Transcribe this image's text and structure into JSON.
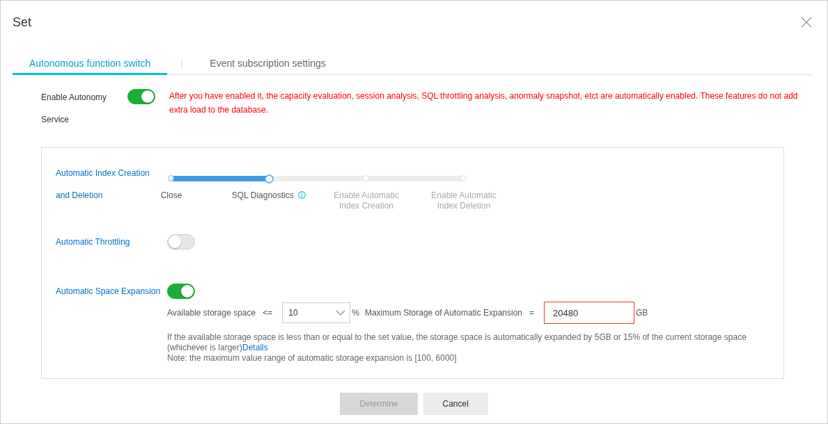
{
  "window": {
    "title": "Set"
  },
  "tabs": [
    {
      "label": "Autonomous function switch",
      "selected": true
    },
    {
      "label": "Event subscription settings",
      "selected": false
    }
  ],
  "autonomy": {
    "label": "Enable Autonomy Service",
    "on": true,
    "notice": "After you have enabled it, the capacity evaluation, session analysis, SQL throttling analysis, anormaly snapshot, etct are automatically enabled. These features do not add extra load to the database."
  },
  "index_setting": {
    "label": "Automatic Index Creation and Deletion",
    "level": 0.3333,
    "steps": [
      {
        "label": "Close",
        "selected": false,
        "info": false
      },
      {
        "label": "SQL Diagnostics",
        "selected": true,
        "info": true
      },
      {
        "label": "Enable Automatic Index Creation",
        "selected": false,
        "info": false
      },
      {
        "label": "Enable Automatic Index Deletion",
        "selected": false,
        "info": false
      }
    ]
  },
  "throttling": {
    "label": "Automatic Throttling",
    "on": false
  },
  "expansion": {
    "label": "Automatic Space Expansion",
    "on": true,
    "available_label": "Available storage space",
    "operator": "<=",
    "threshold": "10",
    "percent": "%",
    "max_label": "Maximum Storage of Automatic Expansion",
    "equals": "=",
    "max_value": "20480",
    "unit": "GB",
    "max_invalid": true,
    "note": "If the available storage space is less than or equal to the set value, the storage space is automatically expanded by 5GB or 15% of the current storage space (whichever is larger)",
    "details_link": "Details",
    "range_note": "Note: the maximum value range of automatic storage expansion is [100, 6000]"
  },
  "buttons": [
    {
      "label": "Determine",
      "disabled": true
    },
    {
      "label": "Cancel",
      "disabled": false
    }
  ]
}
